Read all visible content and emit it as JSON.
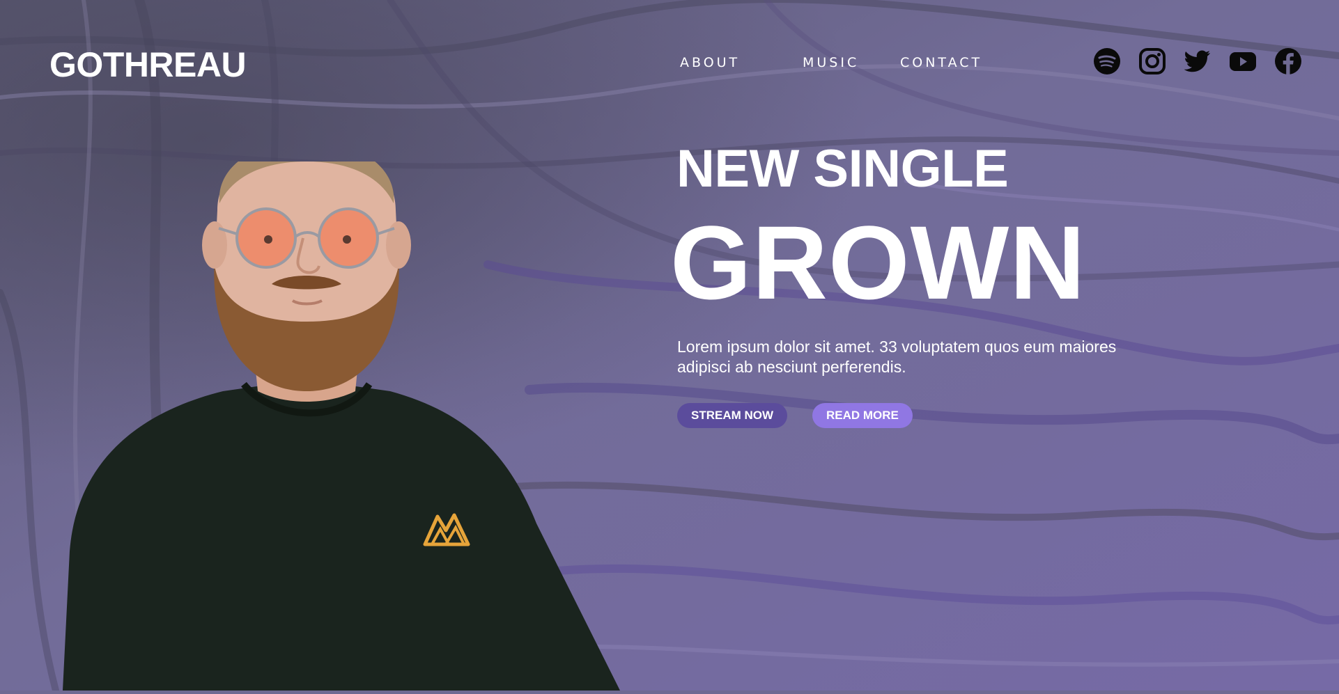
{
  "header": {
    "logo": "GOTHREAU",
    "nav": [
      {
        "label": "ABOUT"
      },
      {
        "label": "MUSIC"
      },
      {
        "label": "CONTACT"
      }
    ],
    "social": [
      {
        "icon": "spotify-icon"
      },
      {
        "icon": "instagram-icon"
      },
      {
        "icon": "twitter-icon"
      },
      {
        "icon": "youtube-icon"
      },
      {
        "icon": "facebook-icon"
      }
    ]
  },
  "hero": {
    "eyebrow": "NEW SINGLE",
    "title": "GROWN",
    "description": "Lorem ipsum dolor sit amet. 33 voluptatem quos eum maiores adipisci ab nesciunt perferendis.",
    "buttons": {
      "stream": "STREAM NOW",
      "read": "READ MORE"
    }
  },
  "colors": {
    "background": "#6f6a92",
    "stream_button": "#5b4c9c",
    "read_button": "#9077e3",
    "text": "#ffffff"
  }
}
